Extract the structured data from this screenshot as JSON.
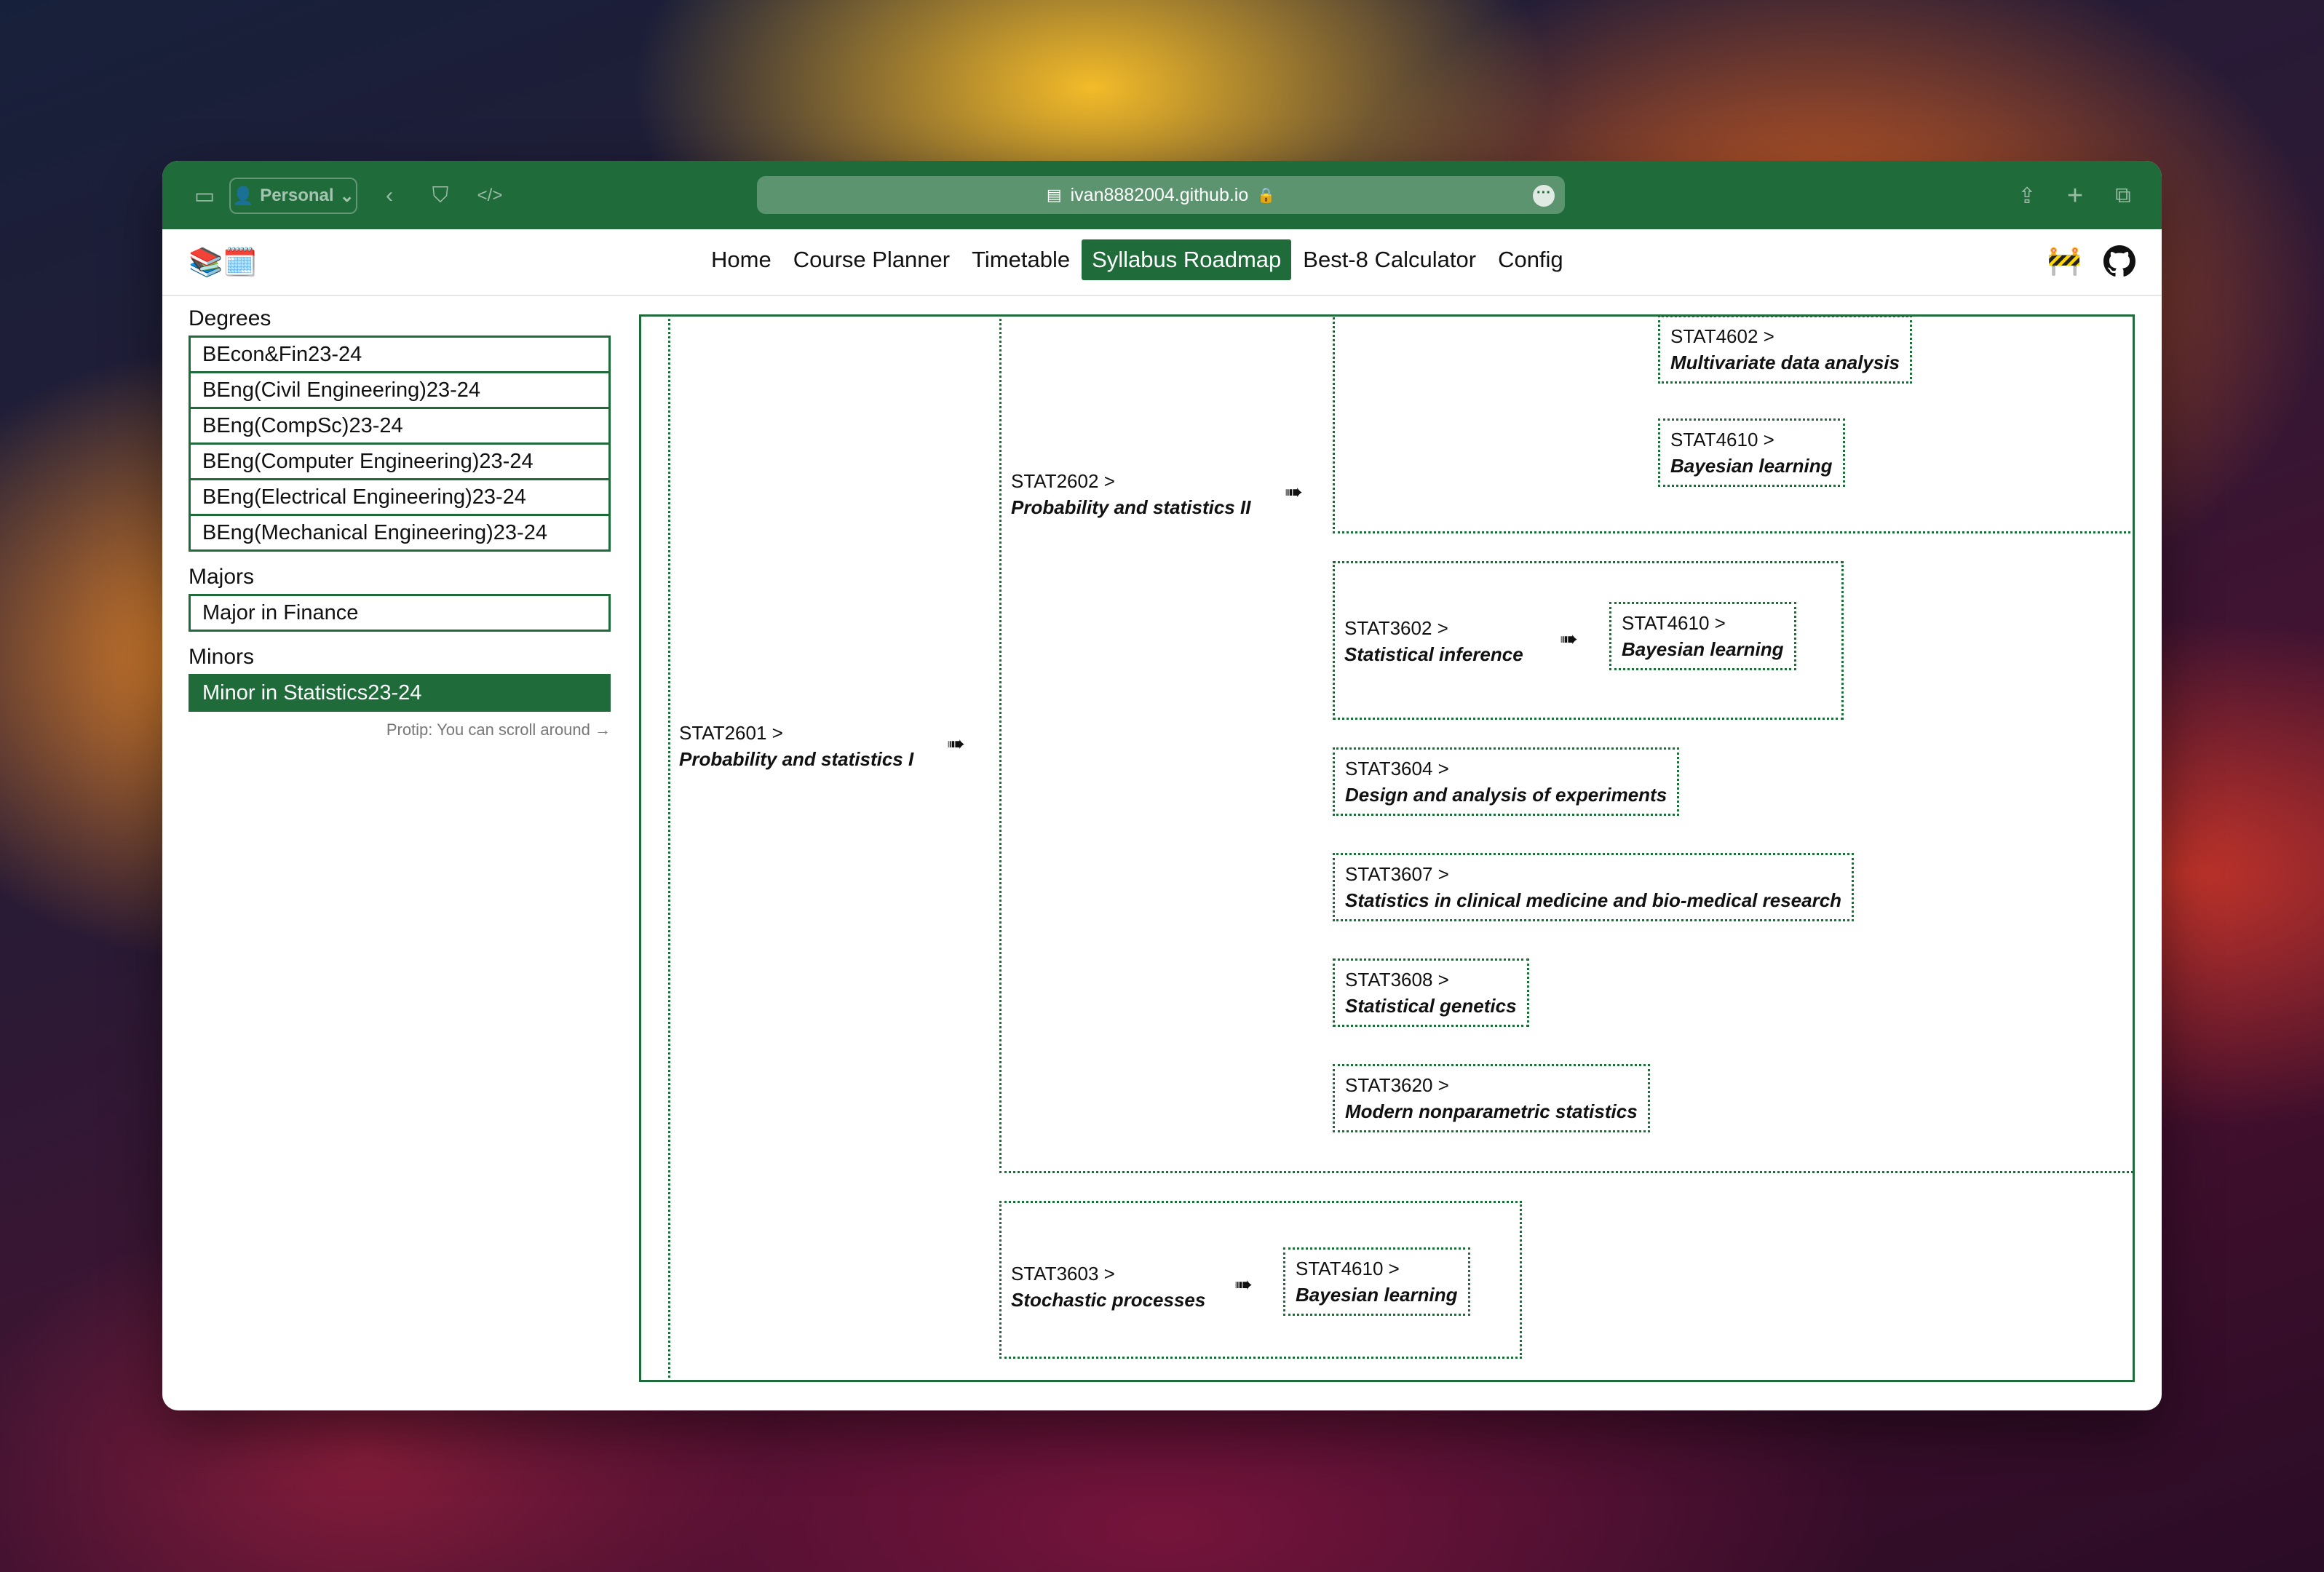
{
  "browser": {
    "profile_label": "Personal",
    "url": "ivan8882004.github.io",
    "lock_icon": "lock-icon"
  },
  "nav": {
    "logo": "📚🗓️",
    "links": [
      "Home",
      "Course Planner",
      "Timetable",
      "Syllabus Roadmap",
      "Best-8 Calculator",
      "Config"
    ],
    "active": "Syllabus Roadmap",
    "right_icons": [
      "construction-icon",
      "github-icon"
    ]
  },
  "sidebar": {
    "degrees_title": "Degrees",
    "degrees": [
      "BEcon&Fin23-24",
      "BEng(Civil Engineering)23-24",
      "BEng(CompSc)23-24",
      "BEng(Computer Engineering)23-24",
      "BEng(Electrical Engineering)23-24",
      "BEng(Mechanical Engineering)23-24"
    ],
    "majors_title": "Majors",
    "majors": [
      "Major in Finance"
    ],
    "minors_title": "Minors",
    "minors": [
      "Minor in Statistics23-24"
    ],
    "selected": "Minor in Statistics23-24",
    "protip": "Protip: You can scroll around →"
  },
  "roadmap": {
    "arrow": "➠",
    "root": {
      "code": "STAT2601 >",
      "name": "Probability and statistics I"
    },
    "stat2602": {
      "code": "STAT2602 >",
      "name": "Probability and statistics II"
    },
    "stat4602": {
      "code": "STAT4602 >",
      "name": "Multivariate data analysis"
    },
    "stat4610_a": {
      "code": "STAT4610 >",
      "name": "Bayesian learning"
    },
    "stat3602": {
      "code": "STAT3602 >",
      "name": "Statistical inference"
    },
    "stat4610_b": {
      "code": "STAT4610 >",
      "name": "Bayesian learning"
    },
    "stat3604": {
      "code": "STAT3604 >",
      "name": "Design and analysis of experiments"
    },
    "stat3607": {
      "code": "STAT3607 >",
      "name": "Statistics in clinical medicine and bio-medical research"
    },
    "stat3608": {
      "code": "STAT3608 >",
      "name": "Statistical genetics"
    },
    "stat3620": {
      "code": "STAT3620 >",
      "name": "Modern nonparametric statistics"
    },
    "stat3603": {
      "code": "STAT3603 >",
      "name": "Stochastic processes"
    },
    "stat4610_c": {
      "code": "STAT4610 >",
      "name": "Bayesian learning"
    }
  }
}
